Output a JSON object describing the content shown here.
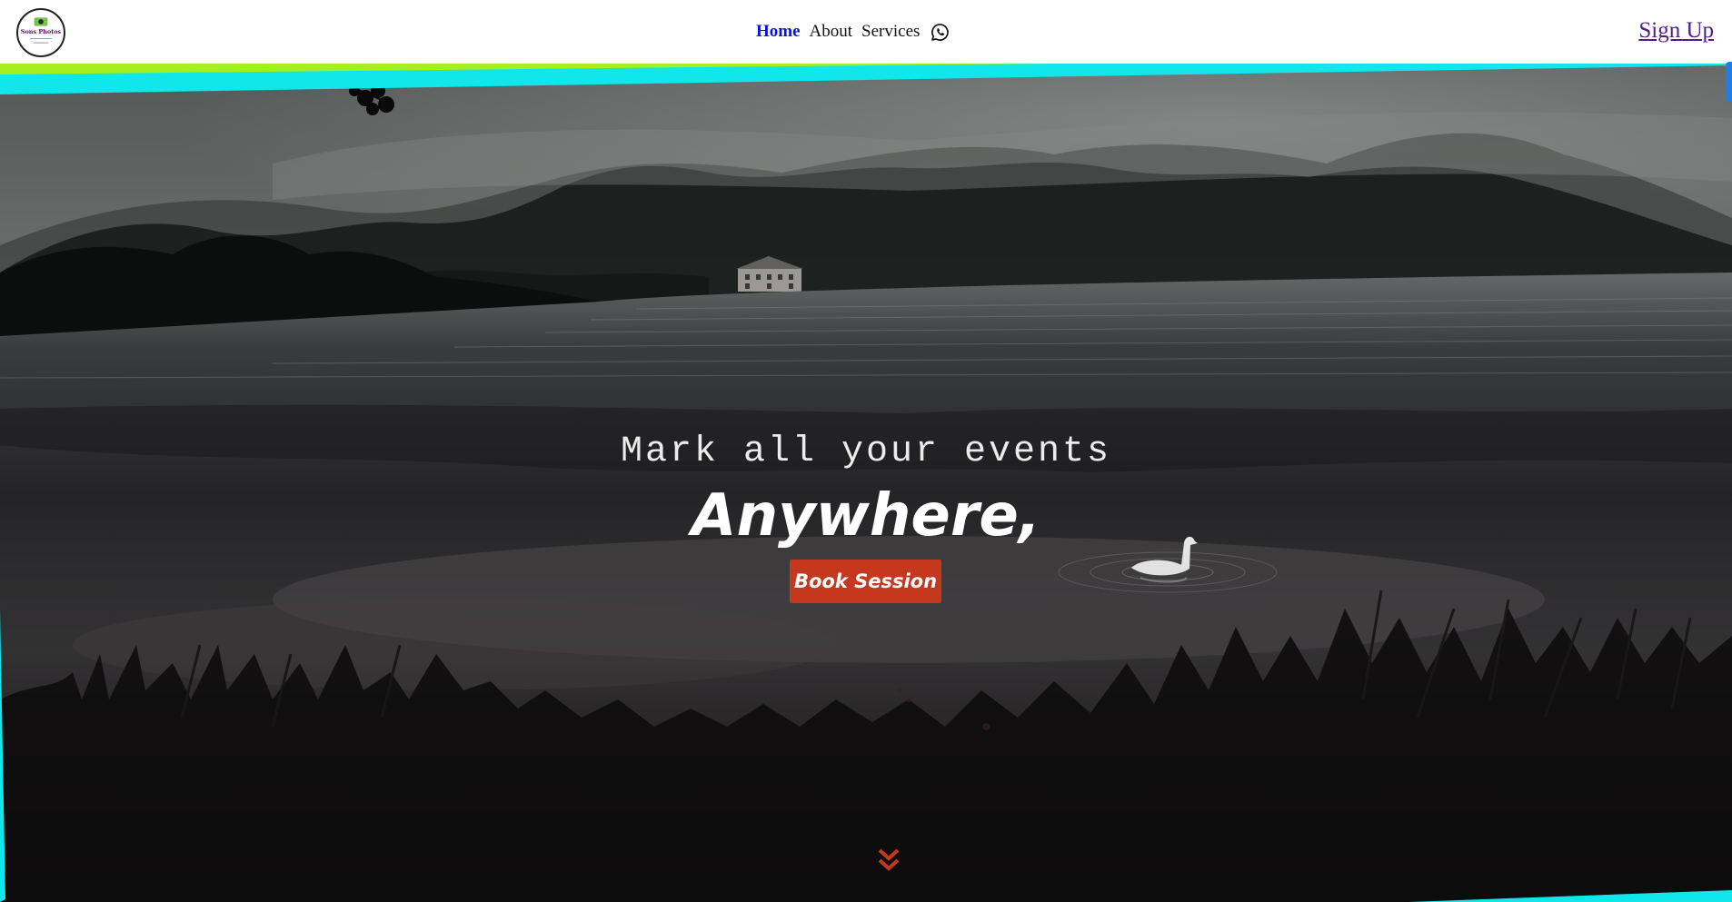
{
  "header": {
    "logo": {
      "icon": "camera-logo-icon",
      "text": "Sons Photos"
    },
    "nav": [
      {
        "label": "Home",
        "active": true
      },
      {
        "label": "About",
        "active": false
      },
      {
        "label": "Services",
        "active": false
      }
    ],
    "whatsapp_icon": "whatsapp-icon",
    "signup_label": "Sign Up"
  },
  "hero": {
    "tagline": "Mark all your events",
    "headline": "Anywhere,",
    "cta_label": "Book Session",
    "scroll_icon": "double-chevron-down-icon"
  },
  "colors": {
    "accent": "#c4391d",
    "nav_active": "#0b14d6",
    "signup_link": "#551a8b",
    "stripe_cyan": "#11e6ea",
    "stripe_lime": "#a4ef1e",
    "edge_tab": "#1e7ee6"
  }
}
